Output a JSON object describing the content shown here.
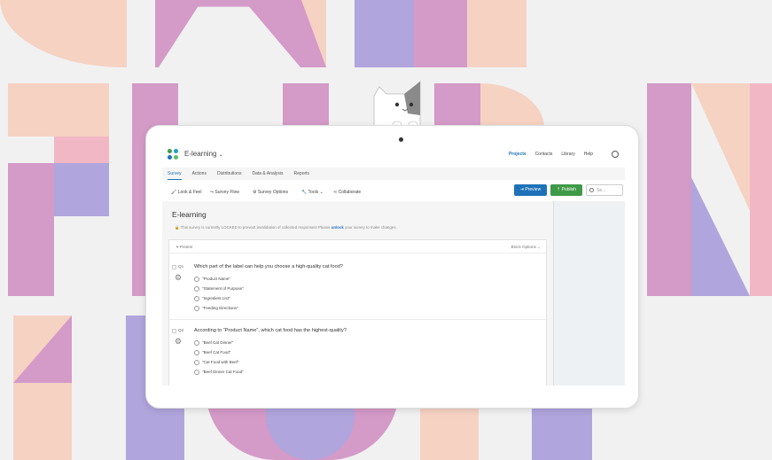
{
  "colors": {
    "pink": "#f6d2c3",
    "magenta": "#d49ac8",
    "lavender": "#b0a5dc",
    "rose": "#f2b7c5",
    "primary": "#1f72b8",
    "publish": "#3f9a48"
  },
  "app": {
    "project_name": "E-learning",
    "chevron": "⌄"
  },
  "topnav": [
    "Projects",
    "Contacts",
    "Library",
    "Help"
  ],
  "tabs": [
    "Survey",
    "Actions",
    "Distributions",
    "Data & Analysis",
    "Reports"
  ],
  "toolbar": {
    "look_feel": "Look & Feel",
    "survey_flow": "Survey Flow",
    "survey_options": "Survey Options",
    "tools": "Tools",
    "collaborate": "Collaborate",
    "preview": "Preview",
    "publish": "Publish",
    "search_placeholder": "Se..."
  },
  "survey": {
    "title": "E-learning",
    "lock_before": "This survey is currently LOCKED to prevent invalidation of collected responses! Please ",
    "lock_link": "unlock",
    "lock_after": " your survey to make changes.",
    "block_name": "Pretest",
    "block_options": "Block Options",
    "questions": [
      {
        "number": "Q1",
        "text": "Which part of the label can help you choose a high-quality cat food?",
        "choices": [
          "\"Product Name\"",
          "\"Statement of Purpose\"",
          "\"Ingredient List\"",
          "\"Feeding Directions\""
        ]
      },
      {
        "number": "Q2",
        "text": "According to \"Product Name\", which cat food has the highest-quality?",
        "choices": [
          "\"Beef Cat Dinner\"",
          "\"Beef Cat Food\"",
          "\"Cat Food with Beef\"",
          "\"Beef Dinner Cat Food\""
        ]
      }
    ]
  },
  "icons": [
    "logo-icon",
    "user-icon",
    "paintbrush-icon",
    "flow-icon",
    "gear-icon",
    "wrench-icon",
    "share-icon",
    "preview-icon",
    "publish-icon",
    "search-icon",
    "lock-icon",
    "chevron-down-icon",
    "settings-gear-icon",
    "radio-icon",
    "cat-illustration"
  ]
}
